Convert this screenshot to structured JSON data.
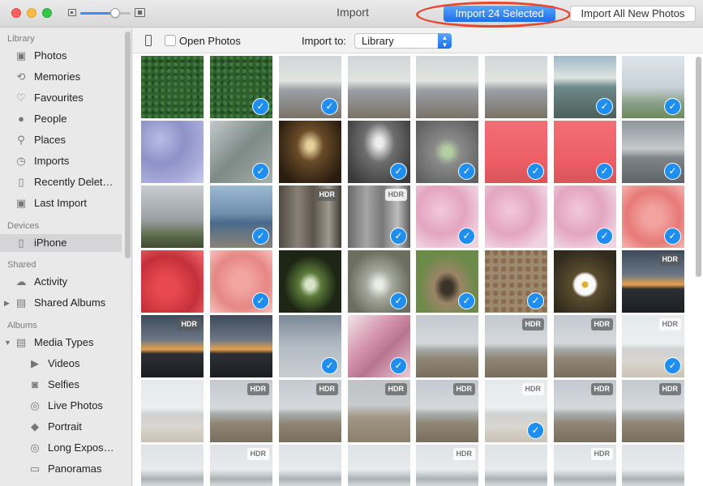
{
  "window": {
    "title": "Import",
    "import_selected_label": "Import 24 Selected",
    "import_all_label": "Import All New Photos",
    "zoom_level": 0.7
  },
  "sidebar": {
    "sections": [
      {
        "header": "Library",
        "items": [
          {
            "label": "Photos",
            "icon": "photos-icon"
          },
          {
            "label": "Memories",
            "icon": "memories-icon"
          },
          {
            "label": "Favourites",
            "icon": "heart-icon"
          },
          {
            "label": "People",
            "icon": "person-icon"
          },
          {
            "label": "Places",
            "icon": "pin-icon"
          },
          {
            "label": "Imports",
            "icon": "clock-icon"
          },
          {
            "label": "Recently Delet…",
            "icon": "trash-icon"
          },
          {
            "label": "Last Import",
            "icon": "photos-icon"
          }
        ]
      },
      {
        "header": "Devices",
        "items": [
          {
            "label": "iPhone",
            "icon": "iphone-icon",
            "selected": true
          }
        ]
      },
      {
        "header": "Shared",
        "items": [
          {
            "label": "Activity",
            "icon": "cloud-icon"
          },
          {
            "label": "Shared Albums",
            "icon": "shared-albums-icon",
            "disclosure": "collapsed"
          }
        ]
      },
      {
        "header": "Albums",
        "items": [
          {
            "label": "Media Types",
            "icon": "folder-icon",
            "disclosure": "expanded"
          },
          {
            "label": "Videos",
            "icon": "video-icon",
            "sub": true
          },
          {
            "label": "Selfies",
            "icon": "camera-icon",
            "sub": true
          },
          {
            "label": "Live Photos",
            "icon": "live-photo-icon",
            "sub": true
          },
          {
            "label": "Portrait",
            "icon": "cube-icon",
            "sub": true
          },
          {
            "label": "Long Expos…",
            "icon": "long-exposure-icon",
            "sub": true
          },
          {
            "label": "Panoramas",
            "icon": "panorama-icon",
            "sub": true
          }
        ]
      }
    ]
  },
  "toolbar": {
    "open_photos_label": "Open Photos",
    "open_photos_checked": false,
    "import_to_label": "Import to:",
    "import_to_value": "Library"
  },
  "photos": {
    "hdr_label": "HDR",
    "checkmark": "✓",
    "items": [
      {
        "scene": "ivy",
        "selected": false,
        "hdr": false
      },
      {
        "scene": "ivy",
        "selected": true,
        "hdr": false
      },
      {
        "scene": "beach-child",
        "selected": true,
        "hdr": false
      },
      {
        "scene": "beach-child",
        "selected": false,
        "hdr": false
      },
      {
        "scene": "beach-child",
        "selected": false,
        "hdr": false
      },
      {
        "scene": "beach-child",
        "selected": false,
        "hdr": false
      },
      {
        "scene": "sea-coast",
        "selected": true,
        "hdr": false
      },
      {
        "scene": "sea-flowers",
        "selected": true,
        "hdr": false
      },
      {
        "scene": "hydrangea-blue",
        "selected": false,
        "hdr": false
      },
      {
        "scene": "rock-hand",
        "selected": true,
        "hdr": false
      },
      {
        "scene": "church-window",
        "selected": false,
        "hdr": false
      },
      {
        "scene": "church-window-grey",
        "selected": true,
        "hdr": false
      },
      {
        "scene": "arch-grey",
        "selected": true,
        "hdr": false
      },
      {
        "scene": "red-lighthouse",
        "selected": true,
        "hdr": false
      },
      {
        "scene": "red-lighthouse",
        "selected": true,
        "hdr": false
      },
      {
        "scene": "grey-sea",
        "selected": true,
        "hdr": false
      },
      {
        "scene": "cloudy-field",
        "selected": false,
        "hdr": false
      },
      {
        "scene": "child-rocks",
        "selected": true,
        "hdr": false
      },
      {
        "scene": "stone-posts",
        "selected": false,
        "hdr": true
      },
      {
        "scene": "stone-posts-grey",
        "selected": true,
        "hdr": true
      },
      {
        "scene": "hydrangea-pink",
        "selected": true,
        "hdr": false
      },
      {
        "scene": "hydrangea-pink",
        "selected": false,
        "hdr": false
      },
      {
        "scene": "hydrangea-pink",
        "selected": true,
        "hdr": false
      },
      {
        "scene": "peeling-paint",
        "selected": true,
        "hdr": false
      },
      {
        "scene": "red-peel",
        "selected": false,
        "hdr": false
      },
      {
        "scene": "pink-peel",
        "selected": true,
        "hdr": false
      },
      {
        "scene": "tree-arch",
        "selected": false,
        "hdr": false
      },
      {
        "scene": "stone-doorway",
        "selected": true,
        "hdr": false
      },
      {
        "scene": "garden-arch",
        "selected": true,
        "hdr": false
      },
      {
        "scene": "stone-wall",
        "selected": true,
        "hdr": false
      },
      {
        "scene": "daisy",
        "selected": false,
        "hdr": false
      },
      {
        "scene": "sunset-sea",
        "selected": false,
        "hdr": true
      },
      {
        "scene": "sunset-sea",
        "selected": false,
        "hdr": true
      },
      {
        "scene": "sunset-sea",
        "selected": false,
        "hdr": false
      },
      {
        "scene": "grey-sky",
        "selected": true,
        "hdr": false
      },
      {
        "scene": "dog-blanket",
        "selected": true,
        "hdr": false
      },
      {
        "scene": "beach",
        "selected": false,
        "hdr": false
      },
      {
        "scene": "beach",
        "selected": false,
        "hdr": true
      },
      {
        "scene": "beach",
        "selected": false,
        "hdr": true
      },
      {
        "scene": "beach-pale",
        "selected": true,
        "hdr": true
      },
      {
        "scene": "beach-pale",
        "selected": false,
        "hdr": false
      },
      {
        "scene": "beach",
        "selected": false,
        "hdr": true
      },
      {
        "scene": "beach",
        "selected": false,
        "hdr": true
      },
      {
        "scene": "beach-sand",
        "selected": false,
        "hdr": true
      },
      {
        "scene": "beach",
        "selected": false,
        "hdr": true
      },
      {
        "scene": "beach-pale",
        "selected": true,
        "hdr": true
      },
      {
        "scene": "beach",
        "selected": false,
        "hdr": true
      },
      {
        "scene": "beach",
        "selected": false,
        "hdr": true
      },
      {
        "scene": "beach-wave",
        "selected": false,
        "hdr": false
      },
      {
        "scene": "beach-wave",
        "selected": false,
        "hdr": true
      },
      {
        "scene": "beach-wave",
        "selected": false,
        "hdr": false
      },
      {
        "scene": "beach-wave",
        "selected": false,
        "hdr": false
      },
      {
        "scene": "beach-wave",
        "selected": false,
        "hdr": true
      },
      {
        "scene": "beach-wave",
        "selected": false,
        "hdr": false
      },
      {
        "scene": "beach-wave",
        "selected": false,
        "hdr": true
      },
      {
        "scene": "beach-wave",
        "selected": false,
        "hdr": false
      }
    ]
  }
}
